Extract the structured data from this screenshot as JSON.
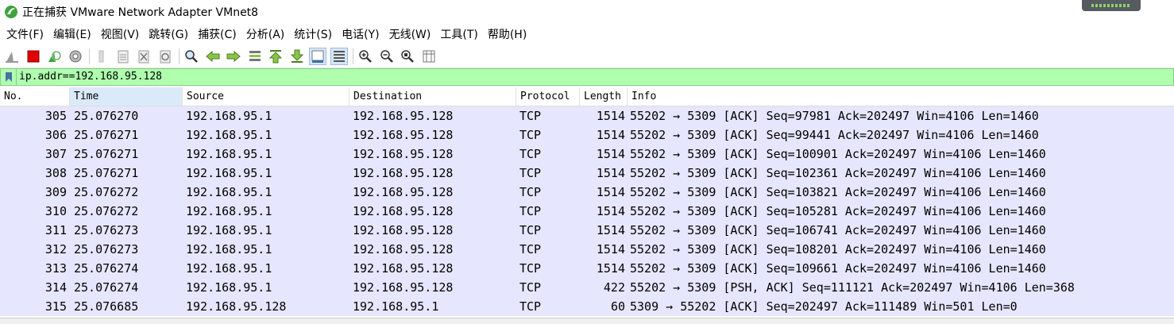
{
  "window": {
    "title": "正在捕获 VMware Network Adapter VMnet8"
  },
  "menu": {
    "items": [
      "文件(F)",
      "编辑(E)",
      "视图(V)",
      "跳转(G)",
      "捕获(C)",
      "分析(A)",
      "统计(S)",
      "电话(Y)",
      "无线(W)",
      "工具(T)",
      "帮助(H)"
    ]
  },
  "toolbar": {
    "icons": [
      "shark-fin-icon",
      "stop-icon",
      "restart-icon",
      "options-gear-icon",
      "open-file-icon",
      "save-file-icon",
      "close-file-icon",
      "reload-icon",
      "find-icon",
      "go-back-icon",
      "go-forward-icon",
      "go-to-packet-icon",
      "first-packet-icon",
      "last-packet-icon",
      "autoscroll-icon",
      "colorize-icon",
      "zoom-in-icon",
      "zoom-out-icon",
      "normal-size-icon",
      "resize-columns-icon"
    ]
  },
  "filter": {
    "value": "ip.addr==192.168.95.128"
  },
  "colors": {
    "filter_bg": "#afffaf",
    "row_bg": "#e7e6ff",
    "stop_red": "#e00000",
    "shark_green": "#3da33d"
  },
  "columns": [
    "No.",
    "Time",
    "Source",
    "Destination",
    "Protocol",
    "Length",
    "Info"
  ],
  "packets": [
    {
      "no": "305",
      "time": "25.076270",
      "src": "192.168.95.1",
      "dst": "192.168.95.128",
      "proto": "TCP",
      "len": "1514",
      "info": "55202 → 5309 [ACK] Seq=97981 Ack=202497 Win=4106 Len=1460"
    },
    {
      "no": "306",
      "time": "25.076271",
      "src": "192.168.95.1",
      "dst": "192.168.95.128",
      "proto": "TCP",
      "len": "1514",
      "info": "55202 → 5309 [ACK] Seq=99441 Ack=202497 Win=4106 Len=1460"
    },
    {
      "no": "307",
      "time": "25.076271",
      "src": "192.168.95.1",
      "dst": "192.168.95.128",
      "proto": "TCP",
      "len": "1514",
      "info": "55202 → 5309 [ACK] Seq=100901 Ack=202497 Win=4106 Len=1460"
    },
    {
      "no": "308",
      "time": "25.076271",
      "src": "192.168.95.1",
      "dst": "192.168.95.128",
      "proto": "TCP",
      "len": "1514",
      "info": "55202 → 5309 [ACK] Seq=102361 Ack=202497 Win=4106 Len=1460"
    },
    {
      "no": "309",
      "time": "25.076272",
      "src": "192.168.95.1",
      "dst": "192.168.95.128",
      "proto": "TCP",
      "len": "1514",
      "info": "55202 → 5309 [ACK] Seq=103821 Ack=202497 Win=4106 Len=1460"
    },
    {
      "no": "310",
      "time": "25.076272",
      "src": "192.168.95.1",
      "dst": "192.168.95.128",
      "proto": "TCP",
      "len": "1514",
      "info": "55202 → 5309 [ACK] Seq=105281 Ack=202497 Win=4106 Len=1460"
    },
    {
      "no": "311",
      "time": "25.076273",
      "src": "192.168.95.1",
      "dst": "192.168.95.128",
      "proto": "TCP",
      "len": "1514",
      "info": "55202 → 5309 [ACK] Seq=106741 Ack=202497 Win=4106 Len=1460"
    },
    {
      "no": "312",
      "time": "25.076273",
      "src": "192.168.95.1",
      "dst": "192.168.95.128",
      "proto": "TCP",
      "len": "1514",
      "info": "55202 → 5309 [ACK] Seq=108201 Ack=202497 Win=4106 Len=1460"
    },
    {
      "no": "313",
      "time": "25.076274",
      "src": "192.168.95.1",
      "dst": "192.168.95.128",
      "proto": "TCP",
      "len": "1514",
      "info": "55202 → 5309 [ACK] Seq=109661 Ack=202497 Win=4106 Len=1460"
    },
    {
      "no": "314",
      "time": "25.076274",
      "src": "192.168.95.1",
      "dst": "192.168.95.128",
      "proto": "TCP",
      "len": "422",
      "info": "55202 → 5309 [PSH, ACK] Seq=111121 Ack=202497 Win=4106 Len=368"
    },
    {
      "no": "315",
      "time": "25.076685",
      "src": "192.168.95.128",
      "dst": "192.168.95.1",
      "proto": "TCP",
      "len": "60",
      "info": "5309 → 55202 [ACK] Seq=202497 Ack=111489 Win=501 Len=0"
    }
  ]
}
